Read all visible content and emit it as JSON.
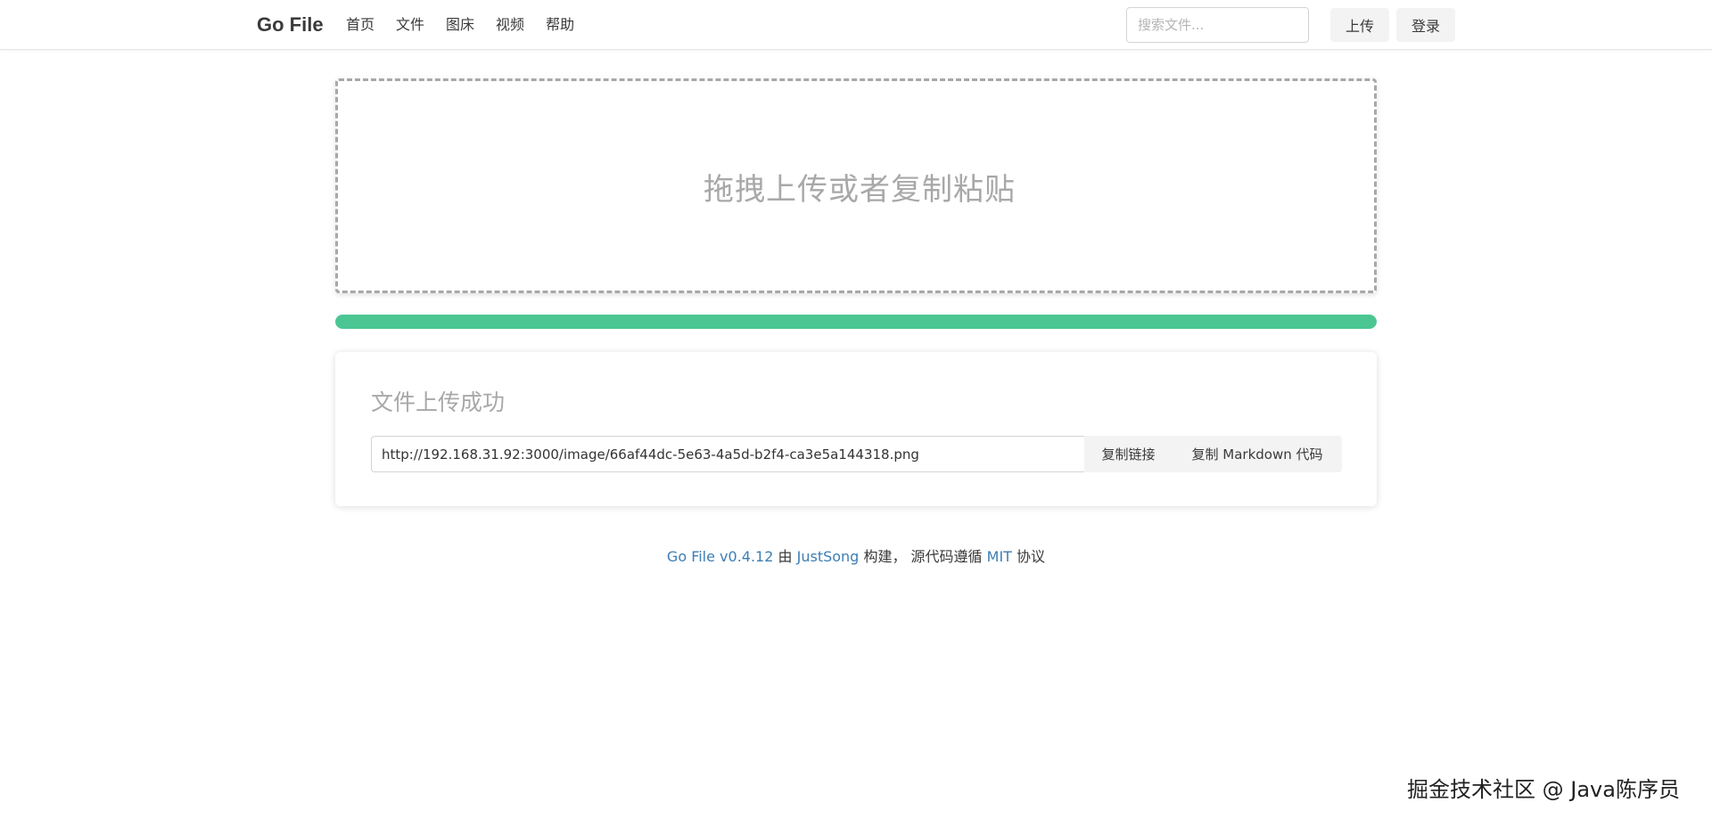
{
  "header": {
    "brand": "Go File",
    "nav": [
      {
        "label": "首页"
      },
      {
        "label": "文件"
      },
      {
        "label": "图床"
      },
      {
        "label": "视频"
      },
      {
        "label": "帮助"
      }
    ],
    "search_placeholder": "搜索文件...",
    "upload_label": "上传",
    "login_label": "登录"
  },
  "dropzone": {
    "text": "拖拽上传或者复制粘贴"
  },
  "progress": {
    "percent": 100,
    "color": "#4bc693"
  },
  "result": {
    "title": "文件上传成功",
    "url": "http://192.168.31.92:3000/image/66af44dc-5e63-4a5d-b2f4-ca3e5a144318.png",
    "copy_link_label": "复制链接",
    "copy_markdown_label": "复制 Markdown 代码"
  },
  "footer": {
    "app_link": "Go File v0.4.12",
    "by": "由",
    "author_link": "JustSong",
    "built": "构建，",
    "source": "源代码遵循",
    "license_link": "MIT",
    "license_suffix": "协议"
  },
  "watermark": "掘金技术社区 @ Java陈序员",
  "colors": {
    "link": "#3d7eb5",
    "muted_text": "#a8a8a8",
    "button_bg": "#f3f3f3"
  }
}
